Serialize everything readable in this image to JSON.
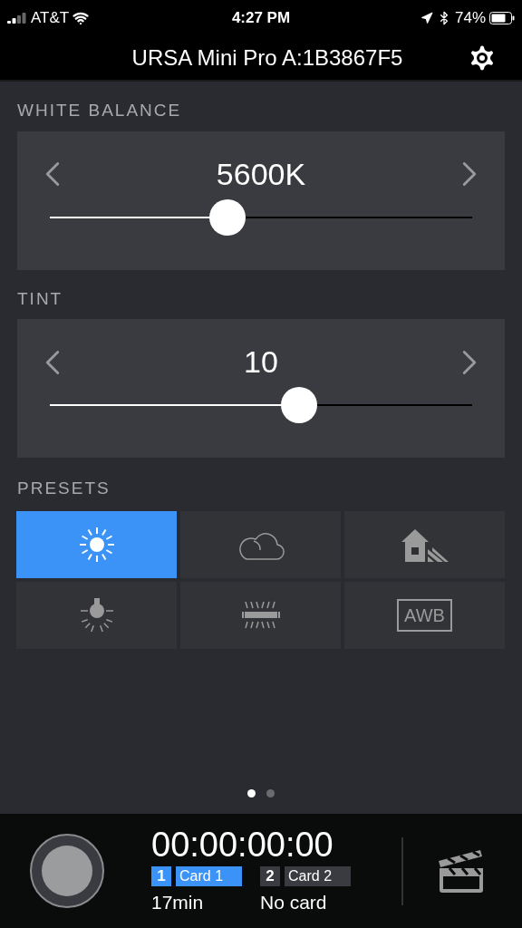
{
  "status_bar": {
    "carrier": "AT&T",
    "time": "4:27 PM",
    "battery": "74%"
  },
  "title": "URSA Mini Pro A:1B3867F5",
  "controls": [
    {
      "label": "WHITE BALANCE",
      "value": "5600K",
      "level": 0.42
    },
    {
      "label": "TINT",
      "value": "10",
      "level": 0.59
    }
  ],
  "presets": {
    "label": "PRESETS",
    "items": [
      {
        "kind": "sun",
        "selected": true
      },
      {
        "kind": "cloud",
        "selected": false
      },
      {
        "kind": "shade",
        "selected": false
      },
      {
        "kind": "tungsten",
        "selected": false
      },
      {
        "kind": "fluorescent",
        "selected": false
      },
      {
        "kind": "awb",
        "text": "AWB",
        "selected": false
      }
    ]
  },
  "pages": [
    {
      "selected": true
    },
    {
      "selected": false
    }
  ],
  "recorder": {
    "timecode": "00:00:00:00",
    "cards": [
      {
        "number": "1",
        "name": "Card 1",
        "status": "17min",
        "selected": true
      },
      {
        "number": "2",
        "name": "Card 2",
        "status": "No card",
        "selected": false
      }
    ]
  }
}
